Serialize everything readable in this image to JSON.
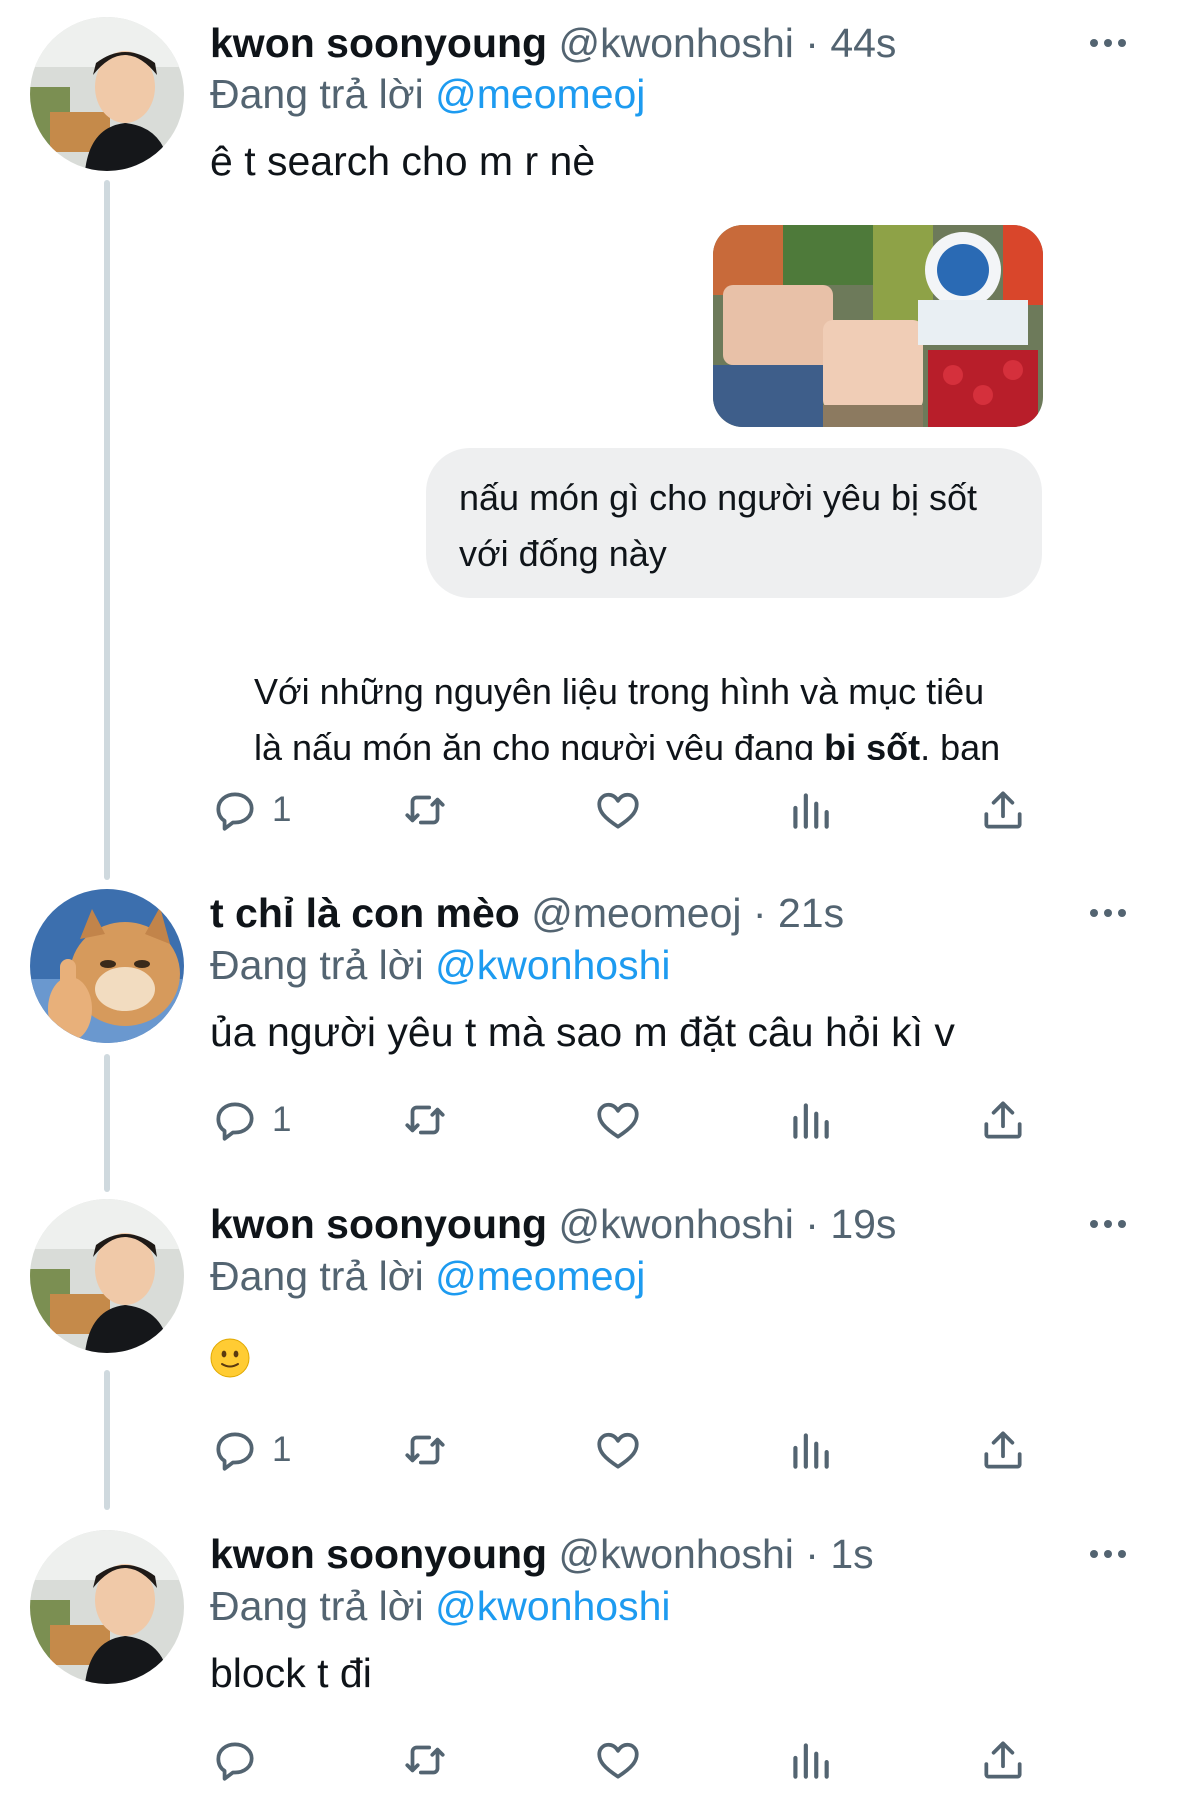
{
  "tweets": [
    {
      "name": "kwon soonyoung",
      "handle": "@kwonhoshi",
      "time": "44s",
      "reply_prefix": "Đang trả lời",
      "reply_to": "@meomeoj",
      "text": "ê t search cho m r nè",
      "embedded": {
        "question": [
          "nấu món gì cho người yêu bị sốt",
          "với đống này"
        ],
        "answer_line1": "Với những nguyên liệu trong hình và mục tiêu",
        "answer_line2_prefix": "là nấu món ăn cho người yêu đang ",
        "answer_line2_bold": "bị sốt",
        "answer_line2_suffix": ", bạn"
      },
      "reply_count": "1"
    },
    {
      "name": "t chỉ là con mèo",
      "handle": "@meomeoj",
      "time": "21s",
      "reply_prefix": "Đang trả lời",
      "reply_to": "@kwonhoshi",
      "text": "ủa người yêu t mà sao m đặt câu hỏi kì v",
      "reply_count": "1"
    },
    {
      "name": "kwon soonyoung",
      "handle": "@kwonhoshi",
      "time": "19s",
      "reply_prefix": "Đang trả lời",
      "reply_to": "@meomeoj",
      "emoji": "slightly-smiling-face",
      "reply_count": "1"
    },
    {
      "name": "kwon soonyoung",
      "handle": "@kwonhoshi",
      "time": "1s",
      "reply_prefix": "Đang trả lời",
      "reply_to": "@kwonhoshi",
      "text": "block t đi",
      "reply_count": ""
    }
  ],
  "separator": "·",
  "icons": [
    "reply-icon",
    "retweet-icon",
    "like-icon",
    "views-icon",
    "share-icon",
    "more-icon"
  ],
  "colors": {
    "mention": "#1d9bf0",
    "secondary": "#536471",
    "thread_line": "#cfd9de"
  }
}
